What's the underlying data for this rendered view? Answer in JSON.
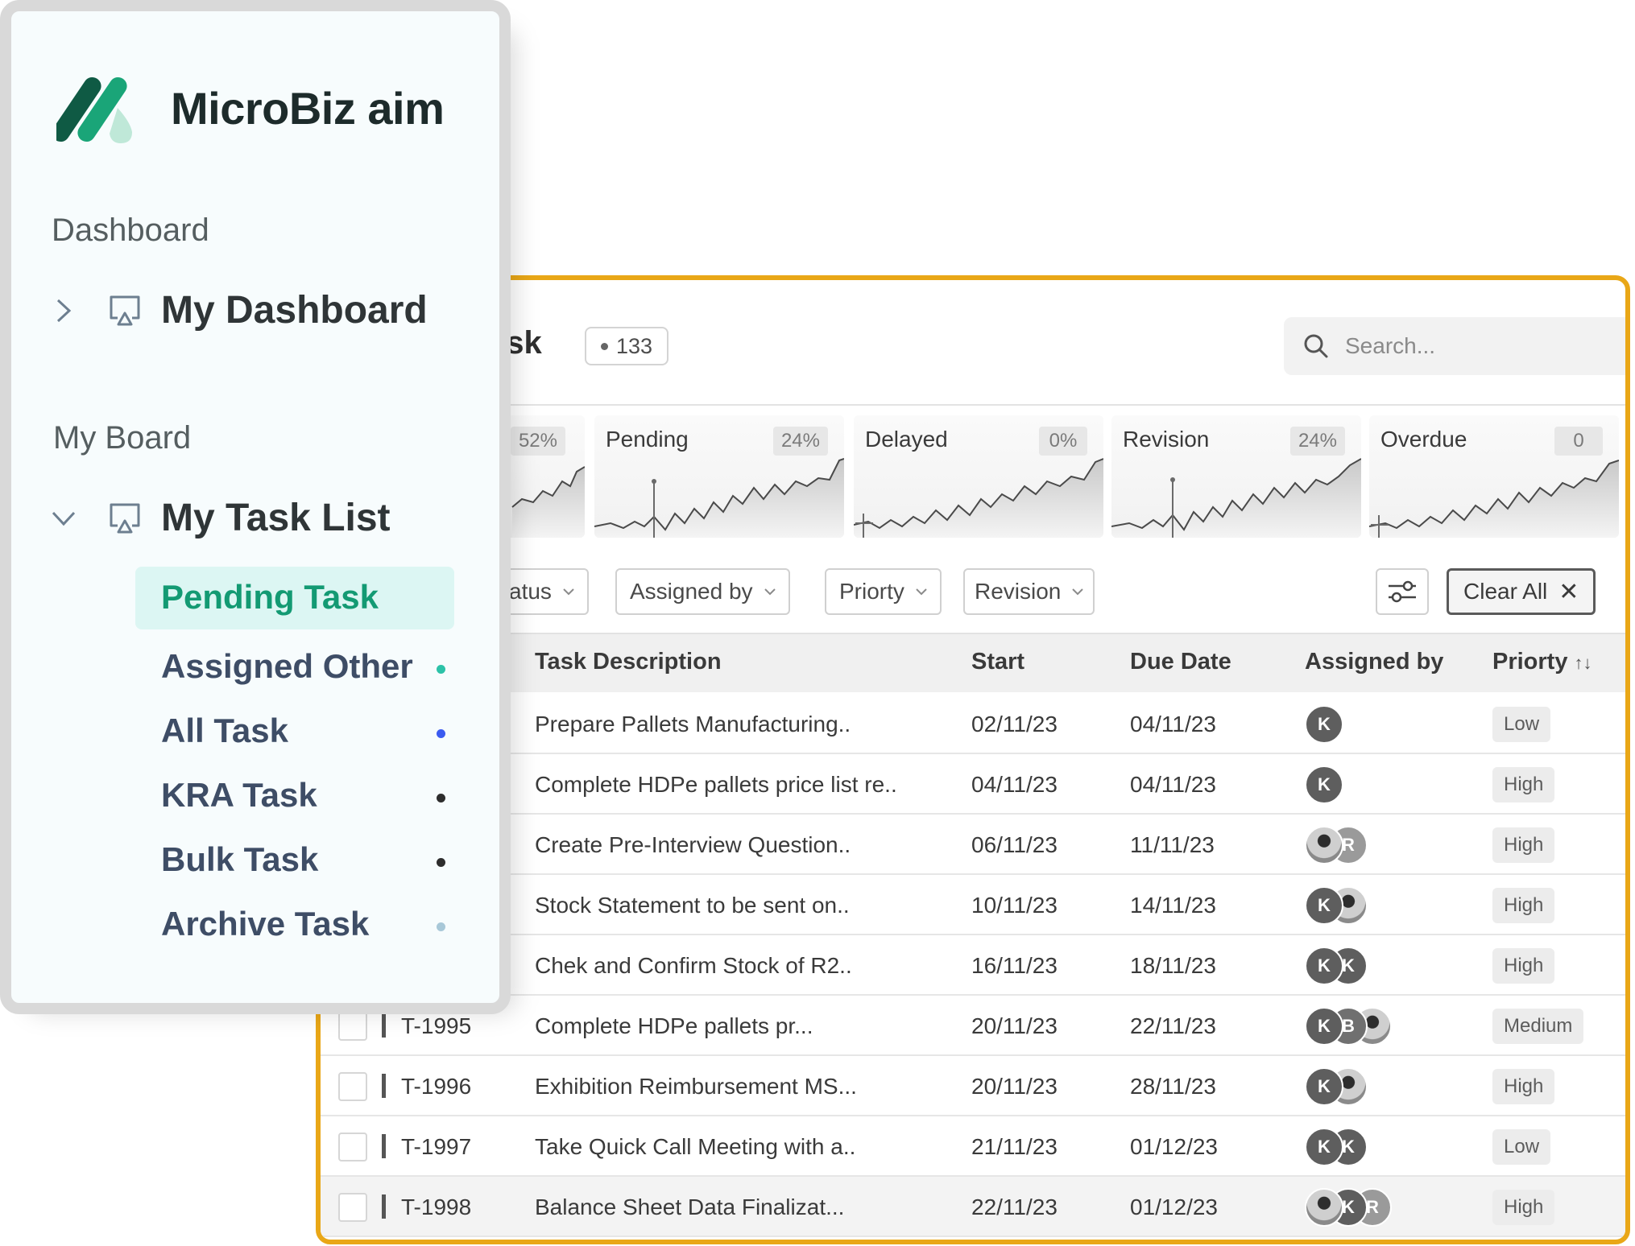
{
  "sidebar": {
    "brand": "MicroBiz aim",
    "dashboard_section": "Dashboard",
    "my_dashboard": "My Dashboard",
    "board_section": "My Board",
    "my_task_list": "My Task List",
    "items": [
      {
        "label": "Pending Task",
        "dot_color": ""
      },
      {
        "label": "Assigned Other",
        "dot_color": "#2cc2a8"
      },
      {
        "label": "All Task",
        "dot_color": "#3b5bf0"
      },
      {
        "label": "KRA Task",
        "dot_color": "#2d2d2d"
      },
      {
        "label": "Bulk Task",
        "dot_color": "#2d2d2d"
      },
      {
        "label": "Archive Task",
        "dot_color": "#a8c8d8"
      }
    ]
  },
  "header": {
    "title": "ask",
    "count": "133",
    "search_placeholder": "Search..."
  },
  "stats": [
    {
      "label": "",
      "percent": "52%"
    },
    {
      "label": "Pending",
      "percent": "24%"
    },
    {
      "label": "Delayed",
      "percent": "0%"
    },
    {
      "label": "Revision",
      "percent": "24%"
    },
    {
      "label": "Overdue",
      "percent": "0"
    }
  ],
  "filters": {
    "status": "atus",
    "assigned_by": "Assigned by",
    "priority": "Priorty",
    "revision": "Revision",
    "clear_all": "Clear All"
  },
  "table": {
    "columns": {
      "description": "Task Description",
      "start": "Start",
      "due": "Due Date",
      "assigned_by": "Assigned by",
      "priority": "Priorty"
    },
    "rows": [
      {
        "id": "",
        "description": "Prepare Pallets Manufacturing..",
        "start": "02/11/23",
        "due": "04/11/23",
        "avatars": [
          "K"
        ],
        "priority": "Low"
      },
      {
        "id": "",
        "description": "Complete HDPe pallets price list re..",
        "start": "04/11/23",
        "due": "04/11/23",
        "avatars": [
          "K"
        ],
        "priority": "High"
      },
      {
        "id": "",
        "description": "Create Pre-Interview Question..",
        "start": "06/11/23",
        "due": "11/11/23",
        "avatars": [
          "photo",
          "R"
        ],
        "priority": "High"
      },
      {
        "id": "",
        "description": "Stock Statement to be sent on..",
        "start": "10/11/23",
        "due": "14/11/23",
        "avatars": [
          "K",
          "photo"
        ],
        "priority": "High"
      },
      {
        "id": "",
        "description": "Chek and Confirm Stock of R2..",
        "start": "16/11/23",
        "due": "18/11/23",
        "avatars": [
          "K",
          "K"
        ],
        "priority": "High"
      },
      {
        "id": "T-1995",
        "description": "Complete HDPe pallets pr...",
        "start": "20/11/23",
        "due": "22/11/23",
        "avatars": [
          "K",
          "B",
          "photo"
        ],
        "priority": "Medium"
      },
      {
        "id": "T-1996",
        "description": "Exhibition Reimbursement MS...",
        "start": "20/11/23",
        "due": "28/11/23",
        "avatars": [
          "K",
          "photo"
        ],
        "priority": "High"
      },
      {
        "id": "T-1997",
        "description": "Take Quick Call Meeting with a..",
        "start": "21/11/23",
        "due": "01/12/23",
        "avatars": [
          "K",
          "K"
        ],
        "priority": "Low"
      },
      {
        "id": "T-1998",
        "description": "Balance Sheet Data Finalizat...",
        "start": "22/11/23",
        "due": "01/12/23",
        "avatars": [
          "photo",
          "K",
          "R"
        ],
        "priority": "High"
      }
    ]
  }
}
